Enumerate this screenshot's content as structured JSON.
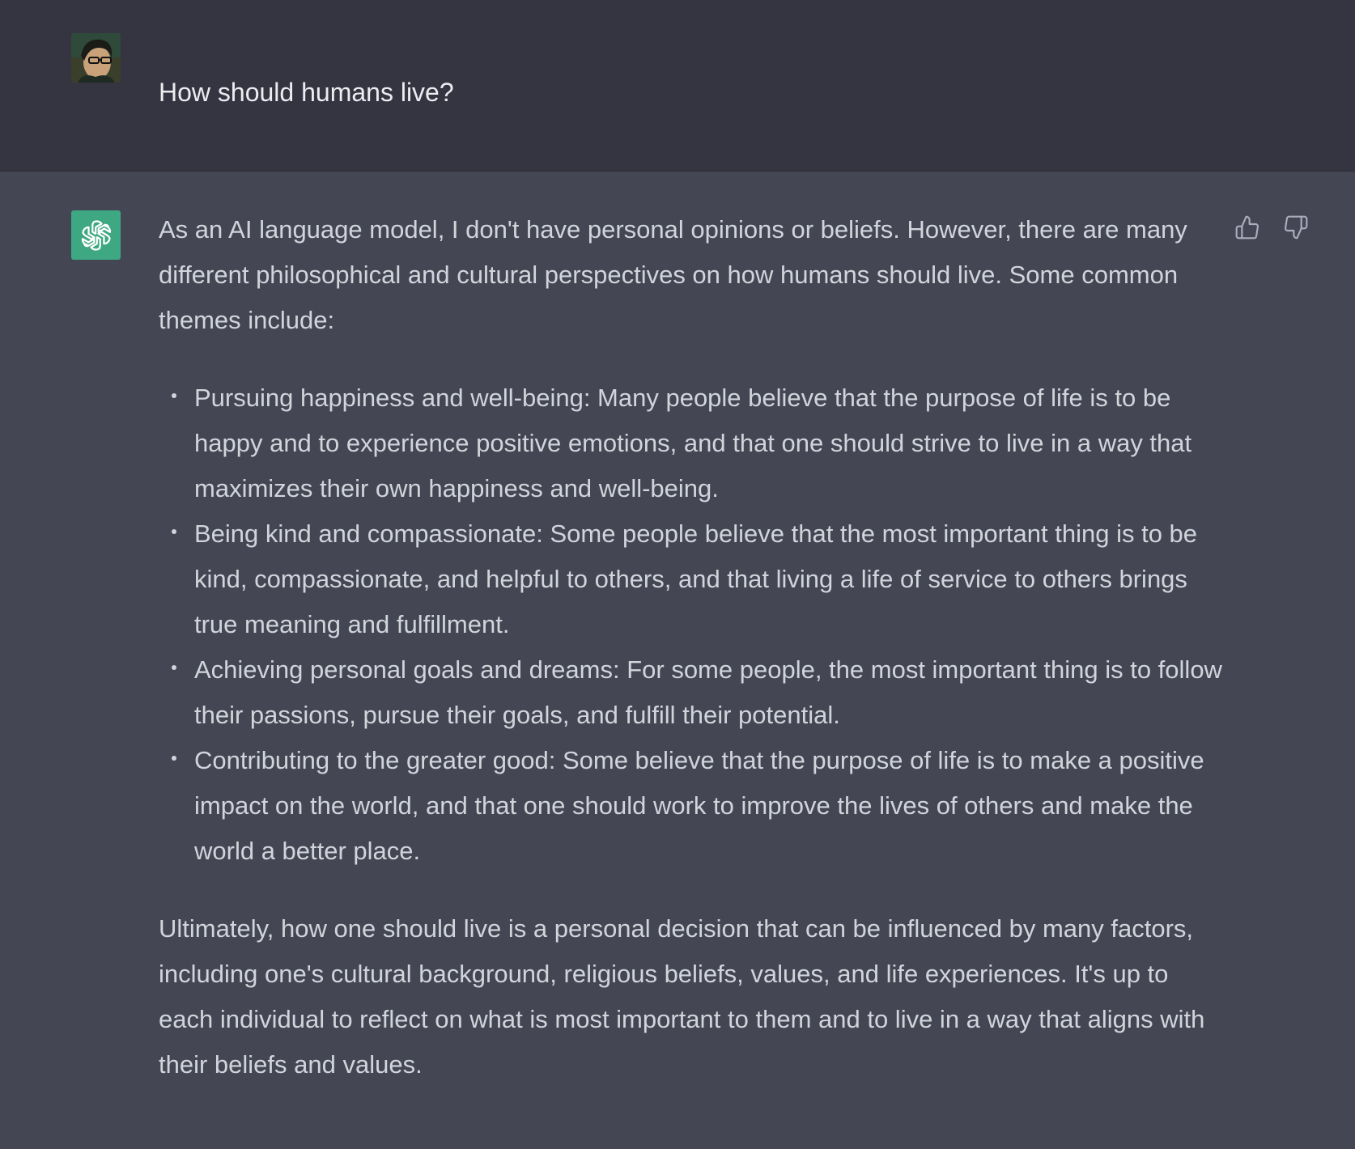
{
  "conversation": {
    "user_message": "How should humans live?",
    "assistant": {
      "intro": "As an AI language model, I don't have personal opinions or beliefs. However, there are many different philosophical and cultural perspectives on how humans should live. Some common themes include:",
      "bullets": [
        "Pursuing happiness and well-being: Many people believe that the purpose of life is to be happy and to experience positive emotions, and that one should strive to live in a way that maximizes their own happiness and well-being.",
        "Being kind and compassionate: Some people believe that the most important thing is to be kind, compassionate, and helpful to others, and that living a life of service to others brings true meaning and fulfillment.",
        "Achieving personal goals and dreams: For some people, the most important thing is to follow their passions, pursue their goals, and fulfill their potential.",
        "Contributing to the greater good: Some believe that the purpose of life is to make a positive impact on the world, and that one should work to improve the lives of others and make the world a better place."
      ],
      "conclusion": "Ultimately, how one should live is a personal decision that can be influenced by many factors, including one's cultural background, religious beliefs, values, and life experiences. It's up to each individual to reflect on what is most important to them and to live in a way that aligns with their beliefs and values."
    }
  },
  "icons": {
    "user_avatar": "user-avatar-photo",
    "assistant_avatar": "openai-logo-icon",
    "thumbs_up": "thumbs-up-icon",
    "thumbs_down": "thumbs-down-icon"
  },
  "colors": {
    "user_row_bg": "#343541",
    "assistant_row_bg": "#444654",
    "assistant_avatar_bg": "#3ea882",
    "text": "#d1d5db"
  }
}
